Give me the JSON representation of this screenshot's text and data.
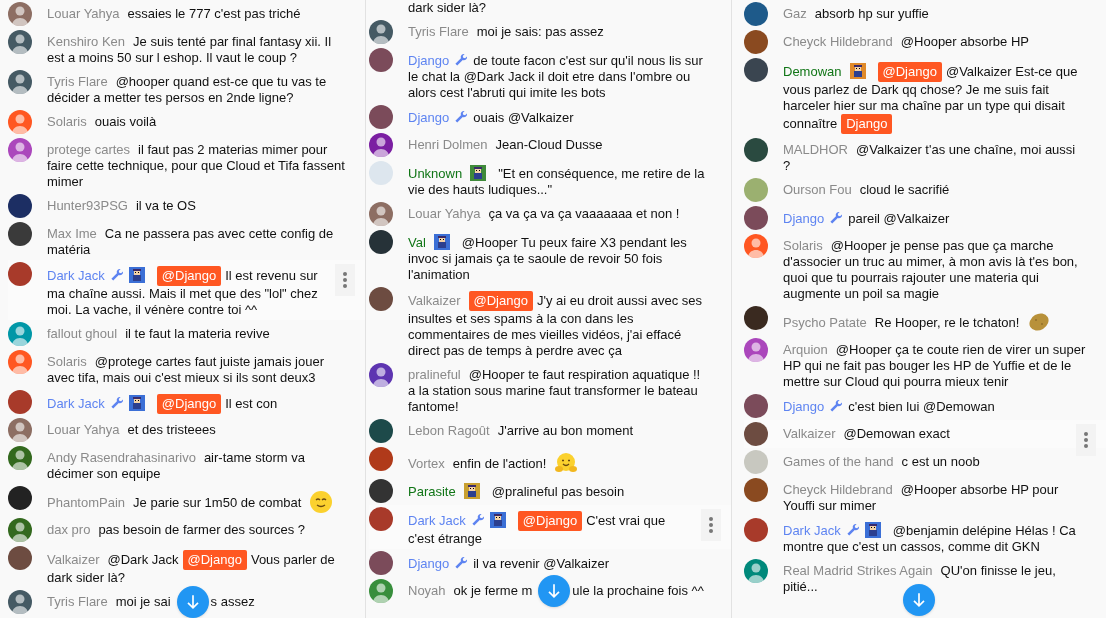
{
  "panels": [
    {
      "messages": [
        {
          "kind": "message",
          "author": "Louar Yahya",
          "moderator": false,
          "member": false,
          "menu_shown": false,
          "avatar": {
            "kind": "silhouette",
            "color": "#8d6e63"
          },
          "parts": [
            {
              "kind": "text",
              "text": "essaies le 777 c'est pas triché"
            }
          ]
        },
        {
          "kind": "message",
          "author": "Kenshiro Ken",
          "moderator": false,
          "member": false,
          "menu_shown": false,
          "avatar": {
            "kind": "silhouette",
            "color": "#455a64"
          },
          "parts": [
            {
              "kind": "text",
              "text": "Je suis tenté par final fantasy xii. Il est a moins 50 sur l eshop. Il vaut le coup ?"
            }
          ]
        },
        {
          "kind": "message",
          "author": "Tyris Flare",
          "moderator": false,
          "member": false,
          "menu_shown": false,
          "avatar": {
            "kind": "silhouette",
            "color": "#455a64"
          },
          "parts": [
            {
              "kind": "text",
              "text": "@hooper quand est-ce que tu vas te décider a metter tes persos en 2nde ligne?"
            }
          ]
        },
        {
          "kind": "message",
          "author": "Solaris",
          "moderator": false,
          "member": false,
          "menu_shown": false,
          "avatar": {
            "kind": "silhouette",
            "color": "#ff5722"
          },
          "parts": [
            {
              "kind": "text",
              "text": "ouais voilà"
            }
          ]
        },
        {
          "kind": "message",
          "author": "protege cartes",
          "moderator": false,
          "member": false,
          "menu_shown": false,
          "avatar": {
            "kind": "silhouette",
            "color": "#ab47bc"
          },
          "parts": [
            {
              "kind": "text",
              "text": "il faut pas 2 materias mimer pour faire cette technique, pour que Cloud et Tifa fassent mimer"
            }
          ]
        },
        {
          "kind": "message",
          "author": "Hunter93PSG",
          "moderator": false,
          "member": false,
          "menu_shown": false,
          "avatar": {
            "kind": "picture",
            "color": "#1c2e63"
          },
          "parts": [
            {
              "kind": "text",
              "text": "il va te OS"
            }
          ]
        },
        {
          "kind": "message",
          "author": "Max Ime",
          "moderator": false,
          "member": false,
          "menu_shown": false,
          "avatar": {
            "kind": "picture",
            "color": "#3a3a3a"
          },
          "parts": [
            {
              "kind": "text",
              "text": "Ca ne passera pas avec cette config de matéria"
            }
          ]
        },
        {
          "kind": "message",
          "author": "Dark Jack",
          "moderator": true,
          "member": true,
          "badge": {
            "color": "#3b6fd6"
          },
          "menu_shown": true,
          "avatar": {
            "kind": "picture",
            "color": "#a83a2a"
          },
          "parts": [
            {
              "kind": "mention",
              "text": "@Django"
            },
            {
              "kind": "text",
              "text": "Il est revenu sur ma chaîne aussi. Mais il met que des \"lol\" chez moi. La vache, il vénère contre toi ^^"
            }
          ]
        },
        {
          "kind": "message",
          "author": "fallout ghoul",
          "moderator": false,
          "member": false,
          "menu_shown": false,
          "avatar": {
            "kind": "silhouette",
            "color": "#0097a7"
          },
          "parts": [
            {
              "kind": "text",
              "text": "il te faut la materia revive"
            }
          ]
        },
        {
          "kind": "message",
          "author": "Solaris",
          "moderator": false,
          "member": false,
          "menu_shown": false,
          "avatar": {
            "kind": "silhouette",
            "color": "#ff5722"
          },
          "parts": [
            {
              "kind": "text",
              "text": "@protege cartes faut juiste jamais jouer avec tifa, mais oui c'est mieux si ils sont deux3"
            }
          ]
        },
        {
          "kind": "message",
          "author": "Dark Jack",
          "moderator": true,
          "member": true,
          "badge": {
            "color": "#3b6fd6"
          },
          "menu_shown": false,
          "avatar": {
            "kind": "picture",
            "color": "#a83a2a"
          },
          "parts": [
            {
              "kind": "mention",
              "text": "@Django"
            },
            {
              "kind": "text",
              "text": "Il est con"
            }
          ]
        },
        {
          "kind": "message",
          "author": "Louar Yahya",
          "moderator": false,
          "member": false,
          "menu_shown": false,
          "avatar": {
            "kind": "silhouette",
            "color": "#8d6e63"
          },
          "parts": [
            {
              "kind": "text",
              "text": "et des tristeees"
            }
          ]
        },
        {
          "kind": "message",
          "author": "Andy Rasendrahasinarivo",
          "moderator": false,
          "member": false,
          "menu_shown": false,
          "avatar": {
            "kind": "silhouette",
            "color": "#33691e"
          },
          "parts": [
            {
              "kind": "text",
              "text": "air-tame storm va décimer son equipe"
            }
          ]
        },
        {
          "kind": "message",
          "author": "PhantomPain",
          "moderator": false,
          "member": false,
          "menu_shown": false,
          "avatar": {
            "kind": "picture",
            "color": "#222222"
          },
          "parts": [
            {
              "kind": "text",
              "text": "Je parie sur 1m50 de combat"
            },
            {
              "kind": "smiley"
            }
          ]
        },
        {
          "kind": "message",
          "author": "dax pro",
          "moderator": false,
          "member": false,
          "menu_shown": false,
          "avatar": {
            "kind": "silhouette",
            "color": "#33691e"
          },
          "parts": [
            {
              "kind": "text",
              "text": "pas besoin de farmer des sources ?"
            }
          ]
        },
        {
          "kind": "message",
          "author": "Valkaizer",
          "moderator": false,
          "member": false,
          "menu_shown": false,
          "avatar": {
            "kind": "picture",
            "color": "#6d4c41"
          },
          "parts": [
            {
              "kind": "text",
              "text": "@Dark Jack"
            },
            {
              "kind": "mention",
              "text": "@Django"
            },
            {
              "kind": "text",
              "text": "Vous parler de dark sider là?"
            }
          ]
        },
        {
          "kind": "message",
          "author": "Tyris Flare",
          "moderator": false,
          "member": false,
          "menu_shown": false,
          "avatar": {
            "kind": "silhouette",
            "color": "#455a64"
          },
          "parts": [
            {
              "kind": "text",
              "text": "moi je sai"
            },
            {
              "kind": "covered"
            },
            {
              "kind": "text",
              "text": "s assez"
            }
          ]
        }
      ]
    },
    {
      "messages": [
        {
          "kind": "fragment",
          "text": "dark sider là?"
        },
        {
          "kind": "message",
          "author": "Tyris Flare",
          "moderator": false,
          "member": false,
          "menu_shown": false,
          "avatar": {
            "kind": "silhouette",
            "color": "#455a64"
          },
          "parts": [
            {
              "kind": "text",
              "text": "moi je sais: pas assez"
            }
          ]
        },
        {
          "kind": "message",
          "author": "Django",
          "moderator": true,
          "member": false,
          "menu_shown": false,
          "avatar": {
            "kind": "picture",
            "color": "#7b4b5a"
          },
          "parts": [
            {
              "kind": "text",
              "text": "de toute facon c'est sur qu'il nous lis sur le chat la @Dark Jack il doit etre dans l'ombre ou alors cest l'abruti qui imite les bots"
            }
          ]
        },
        {
          "kind": "message",
          "author": "Django",
          "moderator": true,
          "member": false,
          "menu_shown": false,
          "avatar": {
            "kind": "picture",
            "color": "#7b4b5a"
          },
          "parts": [
            {
              "kind": "text",
              "text": "ouais @Valkaizer"
            }
          ]
        },
        {
          "kind": "message",
          "author": "Henri Dolmen",
          "moderator": false,
          "member": false,
          "menu_shown": false,
          "avatar": {
            "kind": "silhouette",
            "color": "#7b1fa2"
          },
          "parts": [
            {
              "kind": "text",
              "text": "Jean-Cloud Dusse"
            }
          ]
        },
        {
          "kind": "message",
          "author": "Unknown",
          "moderator": false,
          "member": true,
          "badge": {
            "color": "#3f8a3a"
          },
          "menu_shown": false,
          "avatar": {
            "kind": "picture",
            "color": "#dde6ee"
          },
          "parts": [
            {
              "kind": "text",
              "text": "\"Et en conséquence, me retire de la vie des hauts ludiques...\""
            }
          ]
        },
        {
          "kind": "message",
          "author": "Louar Yahya",
          "moderator": false,
          "member": false,
          "menu_shown": false,
          "avatar": {
            "kind": "silhouette",
            "color": "#8d6e63"
          },
          "parts": [
            {
              "kind": "text",
              "text": "ça va ça va ça vaaaaaaa et non !"
            }
          ]
        },
        {
          "kind": "message",
          "author": "Val",
          "moderator": false,
          "member": true,
          "badge": {
            "color": "#3b6fd6"
          },
          "menu_shown": false,
          "avatar": {
            "kind": "picture",
            "color": "#263238"
          },
          "parts": [
            {
              "kind": "text",
              "text": "@Hooper Tu peux faire X3 pendant les invoc si jamais ça te saoule de revoir 50 fois l'animation"
            }
          ]
        },
        {
          "kind": "message",
          "author": "Valkaizer",
          "moderator": false,
          "member": false,
          "menu_shown": false,
          "avatar": {
            "kind": "picture",
            "color": "#6d4c41"
          },
          "parts": [
            {
              "kind": "mention",
              "text": "@Django"
            },
            {
              "kind": "text",
              "text": "J'y ai eu droit aussi avec ses insultes et ses spams à la con dans les commentaires de mes vieilles vidéos, j'ai effacé direct pas de temps à perdre avec ça"
            }
          ]
        },
        {
          "kind": "message",
          "author": "pralineful",
          "moderator": false,
          "member": false,
          "menu_shown": false,
          "avatar": {
            "kind": "silhouette",
            "color": "#5e35b1"
          },
          "parts": [
            {
              "kind": "text",
              "text": "@Hooper te faut respiration aquatique !! a la station sous marine faut transformer le bateau fantome!"
            }
          ]
        },
        {
          "kind": "message",
          "author": "Lebon Ragoût",
          "moderator": false,
          "member": false,
          "menu_shown": false,
          "avatar": {
            "kind": "picture",
            "color": "#1d4a4a"
          },
          "parts": [
            {
              "kind": "text",
              "text": "J'arrive au bon moment"
            }
          ]
        },
        {
          "kind": "message",
          "author": "Vortex",
          "moderator": false,
          "member": false,
          "menu_shown": false,
          "avatar": {
            "kind": "picture",
            "color": "#b03a1a"
          },
          "parts": [
            {
              "kind": "text",
              "text": "enfin de l'action!"
            },
            {
              "kind": "hug"
            }
          ]
        },
        {
          "kind": "message",
          "author": "Parasite",
          "moderator": false,
          "member": true,
          "badge": {
            "color": "#c9a030"
          },
          "menu_shown": false,
          "avatar": {
            "kind": "picture",
            "color": "#333333"
          },
          "parts": [
            {
              "kind": "text",
              "text": "@pralineful pas besoin"
            }
          ]
        },
        {
          "kind": "message",
          "author": "Dark Jack",
          "moderator": true,
          "member": true,
          "badge": {
            "color": "#3b6fd6"
          },
          "menu_shown": true,
          "avatar": {
            "kind": "picture",
            "color": "#a83a2a"
          },
          "parts": [
            {
              "kind": "mention",
              "text": "@Django"
            },
            {
              "kind": "text",
              "text": "C'est vrai que c'est étrange"
            }
          ]
        },
        {
          "kind": "message",
          "author": "Django",
          "moderator": true,
          "member": false,
          "menu_shown": false,
          "avatar": {
            "kind": "picture",
            "color": "#7b4b5a"
          },
          "parts": [
            {
              "kind": "text",
              "text": "il va revenir @Valkaizer"
            }
          ]
        },
        {
          "kind": "message",
          "author": "Noyah",
          "moderator": false,
          "member": false,
          "menu_shown": false,
          "avatar": {
            "kind": "silhouette",
            "color": "#388e3c"
          },
          "parts": [
            {
              "kind": "text",
              "text": "ok je ferme m"
            },
            {
              "kind": "covered"
            },
            {
              "kind": "text",
              "text": "ule la prochaine fois ^^"
            }
          ]
        }
      ]
    },
    {
      "messages": [
        {
          "kind": "message",
          "author": "Gaz",
          "moderator": false,
          "member": false,
          "menu_shown": false,
          "avatar": {
            "kind": "picture",
            "color": "#1e5a8a"
          },
          "parts": [
            {
              "kind": "text",
              "text": "absorb hp sur yuffie"
            }
          ]
        },
        {
          "kind": "message",
          "author": "Cheyck Hildebrand",
          "moderator": false,
          "member": false,
          "menu_shown": false,
          "avatar": {
            "kind": "picture",
            "color": "#8a4a20"
          },
          "parts": [
            {
              "kind": "text",
              "text": "@Hooper absorbe HP"
            }
          ]
        },
        {
          "kind": "message",
          "author": "Demowan",
          "moderator": false,
          "member": true,
          "badge": {
            "color": "#e08a2a"
          },
          "menu_shown": false,
          "avatar": {
            "kind": "picture",
            "color": "#3a4550"
          },
          "parts": [
            {
              "kind": "mention",
              "text": "@Django"
            },
            {
              "kind": "text",
              "text": "@Valkaizer Est-ce que vous parlez de Dark qq chose? Je me suis fait harceler hier sur ma chaîne par un type qui disait connaître"
            },
            {
              "kind": "mention",
              "text": "Django"
            }
          ]
        },
        {
          "kind": "message",
          "author": "MALDHOR",
          "moderator": false,
          "member": false,
          "menu_shown": false,
          "avatar": {
            "kind": "picture",
            "color": "#2a4a40"
          },
          "parts": [
            {
              "kind": "text",
              "text": "@Valkaizer t'as une chaîne, moi aussi ?"
            }
          ]
        },
        {
          "kind": "message",
          "author": "Ourson Fou",
          "moderator": false,
          "member": false,
          "menu_shown": false,
          "avatar": {
            "kind": "picture",
            "color": "#9bb070"
          },
          "parts": [
            {
              "kind": "text",
              "text": "cloud le sacrifié"
            }
          ]
        },
        {
          "kind": "message",
          "author": "Django",
          "moderator": true,
          "member": false,
          "menu_shown": false,
          "avatar": {
            "kind": "picture",
            "color": "#7b4b5a"
          },
          "parts": [
            {
              "kind": "text",
              "text": "pareil @Valkaizer"
            }
          ]
        },
        {
          "kind": "message",
          "author": "Solaris",
          "moderator": false,
          "member": false,
          "menu_shown": false,
          "avatar": {
            "kind": "silhouette",
            "color": "#ff5722"
          },
          "parts": [
            {
              "kind": "text",
              "text": "@Hooper je pense pas que ça marche d'associer un truc au mimer, à mon avis là t'es bon, quoi que tu pourrais rajouter une materia qui augmente un poil sa magie"
            }
          ]
        },
        {
          "kind": "message",
          "author": "Psycho Patate",
          "moderator": false,
          "member": false,
          "menu_shown": false,
          "avatar": {
            "kind": "picture",
            "color": "#3a2a20"
          },
          "parts": [
            {
              "kind": "text",
              "text": "Re Hooper, re le tchaton!"
            },
            {
              "kind": "potato"
            }
          ]
        },
        {
          "kind": "message",
          "author": "Arquion",
          "moderator": false,
          "member": false,
          "menu_shown": false,
          "avatar": {
            "kind": "silhouette",
            "color": "#ab47bc"
          },
          "parts": [
            {
              "kind": "text",
              "text": "@Hooper ça te coute rien de virer un super HP qui ne fait pas bouger les HP de Yuffie et de le mettre sur Cloud qui pourra mieux tenir"
            }
          ]
        },
        {
          "kind": "message",
          "author": "Django",
          "moderator": true,
          "member": false,
          "menu_shown": false,
          "avatar": {
            "kind": "picture",
            "color": "#7b4b5a"
          },
          "parts": [
            {
              "kind": "text",
              "text": "c'est bien lui @Demowan"
            }
          ]
        },
        {
          "kind": "message",
          "author": "Valkaizer",
          "moderator": false,
          "member": false,
          "menu_shown": true,
          "avatar": {
            "kind": "picture",
            "color": "#6d4c41"
          },
          "parts": [
            {
              "kind": "text",
              "text": "@Demowan exact"
            }
          ]
        },
        {
          "kind": "message",
          "author": "Games of the hand",
          "moderator": false,
          "member": false,
          "menu_shown": false,
          "avatar": {
            "kind": "picture",
            "color": "#c8c8c0"
          },
          "parts": [
            {
              "kind": "text",
              "text": "c est un noob"
            }
          ]
        },
        {
          "kind": "message",
          "author": "Cheyck Hildebrand",
          "moderator": false,
          "member": false,
          "menu_shown": false,
          "avatar": {
            "kind": "picture",
            "color": "#8a4a20"
          },
          "parts": [
            {
              "kind": "text",
              "text": "@Hooper absorbe HP pour Youffi sur mimer"
            }
          ]
        },
        {
          "kind": "message",
          "author": "Dark Jack",
          "moderator": true,
          "member": true,
          "badge": {
            "color": "#3b6fd6"
          },
          "menu_shown": false,
          "avatar": {
            "kind": "picture",
            "color": "#a83a2a"
          },
          "parts": [
            {
              "kind": "text",
              "text": "@benjamin delépine Hélas ! Ca montre que c'est un cassos, comme dit GKN"
            }
          ]
        },
        {
          "kind": "message",
          "author": "Real Madrid Strikes Again",
          "moderator": false,
          "member": false,
          "menu_shown": false,
          "avatar": {
            "kind": "silhouette",
            "color": "#00897b"
          },
          "parts": [
            {
              "kind": "text",
              "text": "QU'on finisse le jeu, pitié..."
            }
          ]
        }
      ]
    }
  ]
}
